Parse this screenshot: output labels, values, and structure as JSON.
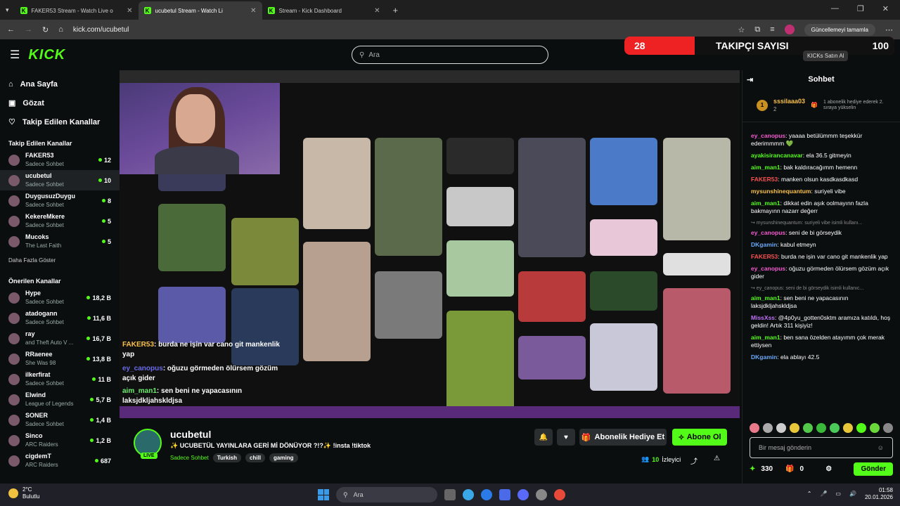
{
  "tabs": [
    {
      "title": "FAKER53 Stream - Watch Live o"
    },
    {
      "title": "ucubetul Stream - Watch Li"
    },
    {
      "title": "Stream - Kick Dashboard"
    }
  ],
  "address": {
    "url": "kick.com/ucubetul",
    "update_label": "Güncellemeyi tamamla"
  },
  "header": {
    "logo": "KICK",
    "search_placeholder": "Ara",
    "follow_count": "28",
    "follow_label": "TAKIPÇI SAYISI",
    "follow_target": "100",
    "kicks_label": "KICKs Satın Al"
  },
  "sidebar": {
    "nav": [
      {
        "label": "Ana Sayfa"
      },
      {
        "label": "Gözat"
      },
      {
        "label": "Takip Edilen Kanallar"
      }
    ],
    "following_heading": "Takip Edilen Kanallar",
    "following": [
      {
        "name": "FAKER53",
        "cat": "Sadece Sohbet",
        "count": "12"
      },
      {
        "name": "ucubetul",
        "cat": "Sadece Sohbet",
        "count": "10"
      },
      {
        "name": "DuygusuzDuygu",
        "cat": "Sadece Sohbet",
        "count": "8"
      },
      {
        "name": "KekereMkere",
        "cat": "Sadece Sohbet",
        "count": "5"
      },
      {
        "name": "Mucoks",
        "cat": "The Last Faith",
        "count": "5"
      }
    ],
    "more_label": "Daha Fazla Göster",
    "recommended_heading": "Önerilen Kanallar",
    "recommended": [
      {
        "name": "Hype",
        "cat": "Sadece Sohbet",
        "count": "18,2 B"
      },
      {
        "name": "atadogann",
        "cat": "Sadece Sohbet",
        "count": "11,6 B"
      },
      {
        "name": "ray",
        "cat": "and Theft Auto V ...",
        "count": "16,7 B"
      },
      {
        "name": "RRaenee",
        "cat": "She Was 98",
        "count": "13,8 B"
      },
      {
        "name": "ilkerfirat",
        "cat": "Sadece Sohbet",
        "count": "11 B"
      },
      {
        "name": "Elwind",
        "cat": "League of Legends",
        "count": "5,7 B"
      },
      {
        "name": "SONER",
        "cat": "Sadece Sohbet",
        "count": "1,4 B"
      },
      {
        "name": "Sinco",
        "cat": "ARC Raiders",
        "count": "1,2 B"
      },
      {
        "name": "cigdemT",
        "cat": "ARC Raiders",
        "count": "687"
      }
    ]
  },
  "overlay_chat": [
    {
      "user": "FAKER53",
      "text": ": burda ne işin var cano git mankenlik yap"
    },
    {
      "user": "ey_canopus",
      "text": ": oğuzu görmeden ölürsem gözüm açık gider"
    },
    {
      "user": "aim_man1",
      "text": ": sen beni ne yapacasının laksjdkljahskldjsa"
    }
  ],
  "stream": {
    "name": "ucubetul",
    "live": "LIVE",
    "title": "✨ UCUBETÜL YAYINLARA GERİ Mİ DÖNÜYOR ?!?✨ !insta !tiktok",
    "category": "Sadece Sohbet",
    "tags": [
      "Turkish",
      "chill",
      "gaming"
    ],
    "gift_label": "Abonelik Hediye Et",
    "sub_label": "Abone Ol",
    "viewers": "10",
    "viewers_label": "İzleyici"
  },
  "chat": {
    "title": "Sohbet",
    "pinned_user": "sssilaaa03",
    "pinned_count": "2",
    "pinned_rank": "1",
    "pinned_desc": "1 abonelik hediye ederek 2. sıraya yükselin",
    "messages": [
      {
        "user": "ey_canopus",
        "color": "#f45ad0",
        "text": ": yaaaa betülümmm teşekkür ederimmmm 💚"
      },
      {
        "user": "ayakisirancanavar",
        "color": "#53fc18",
        "text": ": ela 36.5 gitmeyin"
      },
      {
        "user": "aim_man1",
        "color": "#53fc18",
        "text": ": bak kaldıracağımm hemenn"
      },
      {
        "user": "FAKER53",
        "color": "#f85050",
        "text": ": manken olsun kasdkasdkasd"
      },
      {
        "user": "mysunshinequantum",
        "color": "#f8c04a",
        "text": ": suriyeli vibe"
      },
      {
        "user": "aim_man1",
        "color": "#53fc18",
        "text": ": dikkat edin aşık oolmayınn fazla bakmayınn nazarr değerr"
      },
      {
        "reply": "↪ mysunshinequantum: suriyeli vibe isimli kullanı..."
      },
      {
        "user": "ey_canopus",
        "color": "#f45ad0",
        "text": ": seni de bi görseydik"
      },
      {
        "user": "DKgamin",
        "color": "#6aa8f8",
        "text": ": kabul etmeyn"
      },
      {
        "user": "FAKER53",
        "color": "#f85050",
        "text": ": burda ne işin var cano git mankenlik yap"
      },
      {
        "user": "ey_canopus",
        "color": "#f45ad0",
        "text": ": oğuzu görmeden ölürsem gözüm açık gider"
      },
      {
        "reply": "↪ ey_canopus: seni de bi görseydik isimli kullanıc..."
      },
      {
        "user": "aim_man1",
        "color": "#53fc18",
        "text": ": sen beni ne yapacasının laksjdkljahskldjsa"
      },
      {
        "user": "MissXss",
        "color": "#c070f8",
        "text": ": @4p0yu_gotten0sktm aramıza katıldı, hoş geldin! Artık 311 kişiyiz!"
      },
      {
        "user": "aim_man1",
        "color": "#53fc18",
        "text": ": ben sana özelden atayımm çok merak ettiysen"
      },
      {
        "user": "DKgamin",
        "color": "#6aa8f8",
        "text": ": ela ablayı 42.5"
      }
    ],
    "input_placeholder": "Bir mesaj gönderin",
    "points": "330",
    "gifts": "0",
    "send_label": "Gönder"
  },
  "taskbar": {
    "temp": "2°C",
    "weather": "Bulutlu",
    "search": "Ara",
    "time": "01:58",
    "date": "20.01.2026"
  }
}
